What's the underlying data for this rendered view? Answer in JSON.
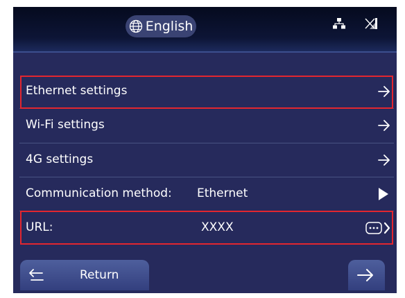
{
  "header": {
    "language": "English",
    "icons": [
      "globe-icon",
      "network-icon",
      "no-signal-icon"
    ]
  },
  "menu": {
    "ethernet": "Ethernet settings",
    "wifi": "Wi-Fi settings",
    "cellular": "4G settings",
    "comm_label": "Communication method:",
    "comm_value": "Ethernet",
    "url_label": "URL:",
    "url_value": "XXXX"
  },
  "footer": {
    "return_label": "Return"
  },
  "colors": {
    "background": "#262a5c",
    "highlight": "#e3262f",
    "text": "#ffffff"
  }
}
